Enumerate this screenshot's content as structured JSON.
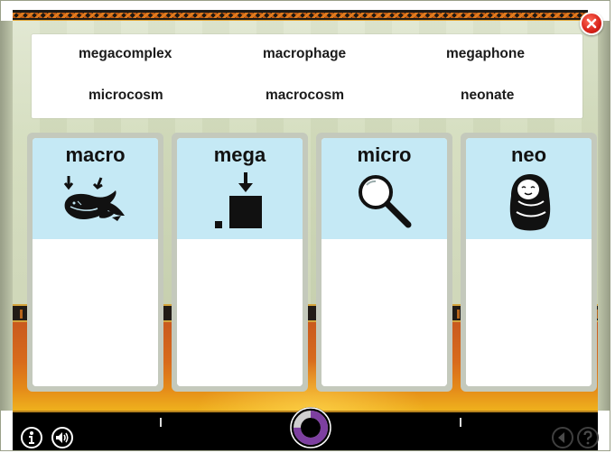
{
  "game": {
    "word_bank": {
      "words": [
        "megacomplex",
        "macrophage",
        "megaphone",
        "microcosm",
        "macrocosm",
        "neonate"
      ]
    },
    "categories": [
      {
        "label": "macro",
        "icon": "whale-icon"
      },
      {
        "label": "mega",
        "icon": "big-square-icon"
      },
      {
        "label": "micro",
        "icon": "magnifying-glass-icon"
      },
      {
        "label": "neo",
        "icon": "swaddled-baby-icon"
      }
    ],
    "controls": {
      "close_icon": "close-icon",
      "info_icon": "info-icon",
      "audio_icon": "speaker-icon",
      "back_icon": "back-icon",
      "help_icon": "help-icon"
    },
    "progress": {
      "fraction": 0.75,
      "color": "#7d3fa0"
    }
  },
  "colors": {
    "header_blue": "#c5e9f5",
    "close_red": "#d8231a",
    "accent_orange": "#e07a1d",
    "progress_purple": "#7d3fa0"
  }
}
